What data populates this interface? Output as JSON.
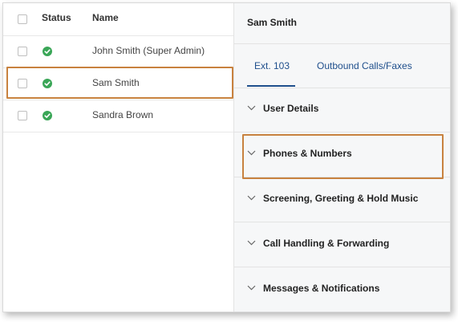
{
  "user_table": {
    "columns": {
      "status": "Status",
      "name": "Name"
    },
    "rows": [
      {
        "name": "John Smith (Super Admin)",
        "status": "active"
      },
      {
        "name": "Sam Smith",
        "status": "active"
      },
      {
        "name": "Sandra Brown",
        "status": "active"
      }
    ]
  },
  "detail_panel": {
    "title": "Sam Smith",
    "tabs": [
      {
        "label": "Ext. 103",
        "active": true
      },
      {
        "label": "Outbound Calls/Faxes",
        "active": false
      }
    ],
    "sections": [
      {
        "label": "User Details"
      },
      {
        "label": "Phones & Numbers"
      },
      {
        "label": "Screening, Greeting & Hold Music"
      },
      {
        "label": "Call Handling & Forwarding"
      },
      {
        "label": "Messages & Notifications"
      }
    ]
  },
  "colors": {
    "status_active": "#3aa657",
    "tab_accent": "#1f4f8c",
    "highlight": "#c8823f"
  }
}
